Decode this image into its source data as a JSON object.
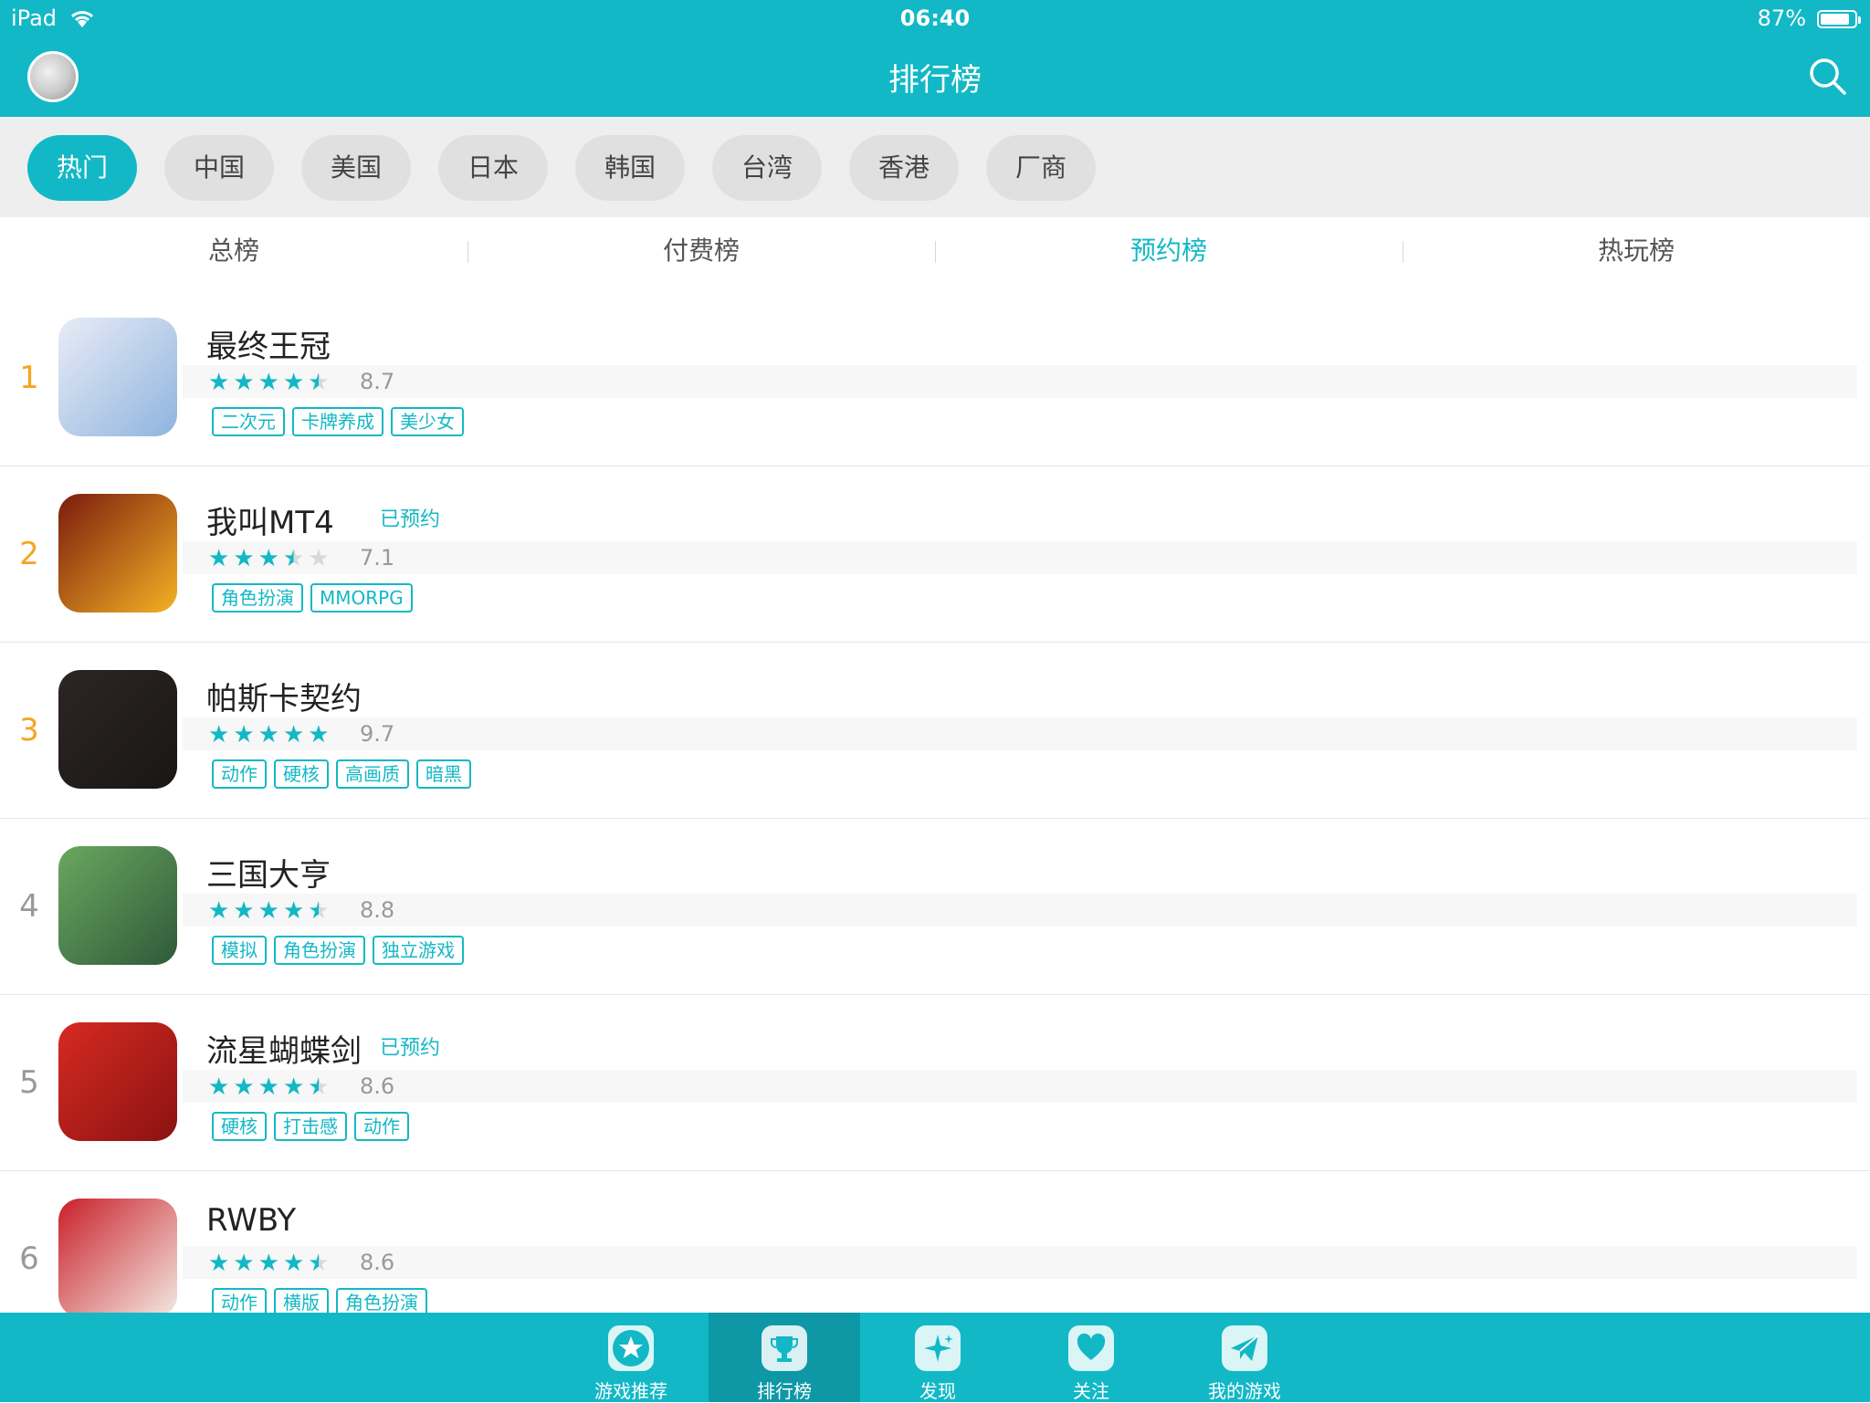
{
  "status_bar": {
    "carrier": "iPad",
    "time": "06:40",
    "battery_text": "87%",
    "battery_level": 0.87
  },
  "header": {
    "title": "排行榜"
  },
  "regions": [
    {
      "label": "热门",
      "active": true
    },
    {
      "label": "中国",
      "active": false
    },
    {
      "label": "美国",
      "active": false
    },
    {
      "label": "日本",
      "active": false
    },
    {
      "label": "韩国",
      "active": false
    },
    {
      "label": "台湾",
      "active": false
    },
    {
      "label": "香港",
      "active": false
    },
    {
      "label": "厂商",
      "active": false
    }
  ],
  "tabs": [
    {
      "label": "总榜",
      "active": false
    },
    {
      "label": "付费榜",
      "active": false
    },
    {
      "label": "预约榜",
      "active": true
    },
    {
      "label": "热玩榜",
      "active": false
    }
  ],
  "games": [
    {
      "rank": "1",
      "name": "最终王冠",
      "reserved": "",
      "rating": 4.35,
      "score": "8.7",
      "tags": [
        "二次元",
        "卡牌养成",
        "美少女"
      ],
      "icon_colors": [
        "#e8ecf5",
        "#8fb4e0"
      ]
    },
    {
      "rank": "2",
      "name": "我叫MT4",
      "reserved": "已预约",
      "rating": 3.55,
      "score": "7.1",
      "tags": [
        "角色扮演",
        "MMORPG"
      ],
      "icon_colors": [
        "#7a1b0d",
        "#f4b225"
      ]
    },
    {
      "rank": "3",
      "name": "帕斯卡契约",
      "reserved": "",
      "rating": 4.85,
      "score": "9.7",
      "tags": [
        "动作",
        "硬核",
        "高画质",
        "暗黑"
      ],
      "icon_colors": [
        "#2b2623",
        "#1a1614"
      ]
    },
    {
      "rank": "4",
      "name": "三国大亨",
      "reserved": "",
      "rating": 4.4,
      "score": "8.8",
      "tags": [
        "模拟",
        "角色扮演",
        "独立游戏"
      ],
      "icon_colors": [
        "#6aa75f",
        "#2f5a3a"
      ]
    },
    {
      "rank": "5",
      "name": "流星蝴蝶剑",
      "reserved": "已预约",
      "rating": 4.3,
      "score": "8.6",
      "tags": [
        "硬核",
        "打击感",
        "动作"
      ],
      "icon_colors": [
        "#d62a21",
        "#8a1212"
      ]
    },
    {
      "rank": "6",
      "name": "RWBY",
      "reserved": "",
      "rating": 4.3,
      "score": "8.6",
      "tags": [
        "动作",
        "横版",
        "角色扮演"
      ],
      "icon_colors": [
        "#c9202a",
        "#f3e9e2"
      ]
    }
  ],
  "bottom_nav": [
    {
      "label": "游戏推荐",
      "icon": "star-icon",
      "active": false
    },
    {
      "label": "排行榜",
      "icon": "trophy-icon",
      "active": true
    },
    {
      "label": "发现",
      "icon": "sparkle-icon",
      "active": false
    },
    {
      "label": "关注",
      "icon": "heart-icon",
      "active": false
    },
    {
      "label": "我的游戏",
      "icon": "paper-plane-icon",
      "active": false
    }
  ],
  "colors": {
    "brand": "#12b8c6",
    "rank_highlight": "#f5a623"
  }
}
